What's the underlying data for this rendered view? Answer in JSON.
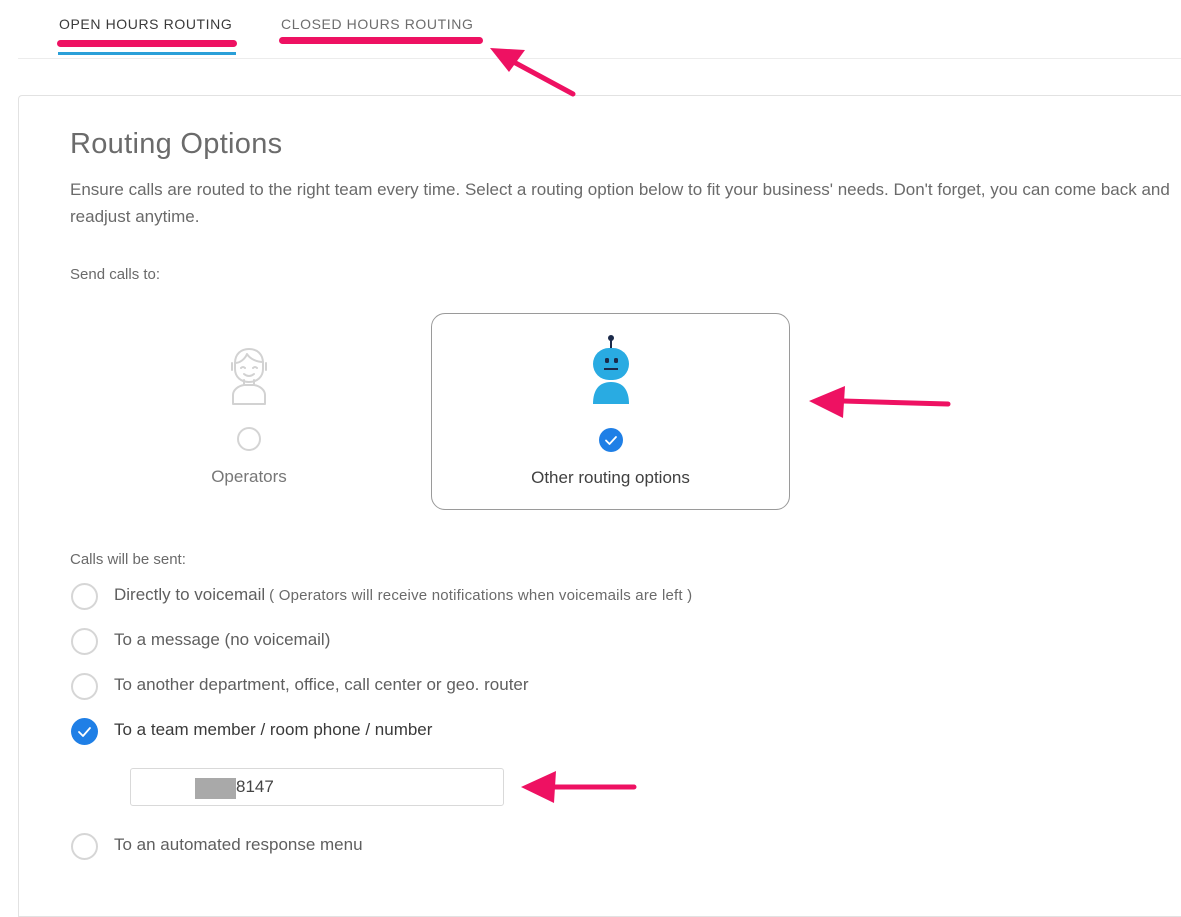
{
  "tabs": {
    "open_label": "OPEN HOURS ROUTING",
    "closed_label": "CLOSED HOURS ROUTING"
  },
  "main": {
    "title": "Routing Options",
    "description": "Ensure calls are routed to the right team every time. Select a routing option below to fit your business' needs. Don't forget, you can come back and readjust anytime.",
    "send_calls_label": "Send calls to:",
    "options": [
      {
        "label": "Operators",
        "selected": false,
        "icon": "operator-face-icon"
      },
      {
        "label": "Other routing options",
        "selected": true,
        "icon": "robot-icon"
      }
    ],
    "calls_sent_label": "Calls will be sent:",
    "routes": [
      {
        "label": "Directly to voicemail",
        "note": "( Operators will receive notifications when voicemails are left )",
        "selected": false
      },
      {
        "label": "To a message (no voicemail)",
        "selected": false
      },
      {
        "label": "To another department, office, call center or geo. router",
        "selected": false
      },
      {
        "label": "To a team member / room phone / number",
        "selected": true
      },
      {
        "label": "To an automated response menu",
        "selected": false
      }
    ],
    "phone_value": "8147"
  },
  "colors": {
    "accent_blue": "#1f7fe6",
    "tab_underline": "#2a9fd8",
    "annotation_pink": "#ee1162",
    "robot_blue": "#29abe2"
  }
}
